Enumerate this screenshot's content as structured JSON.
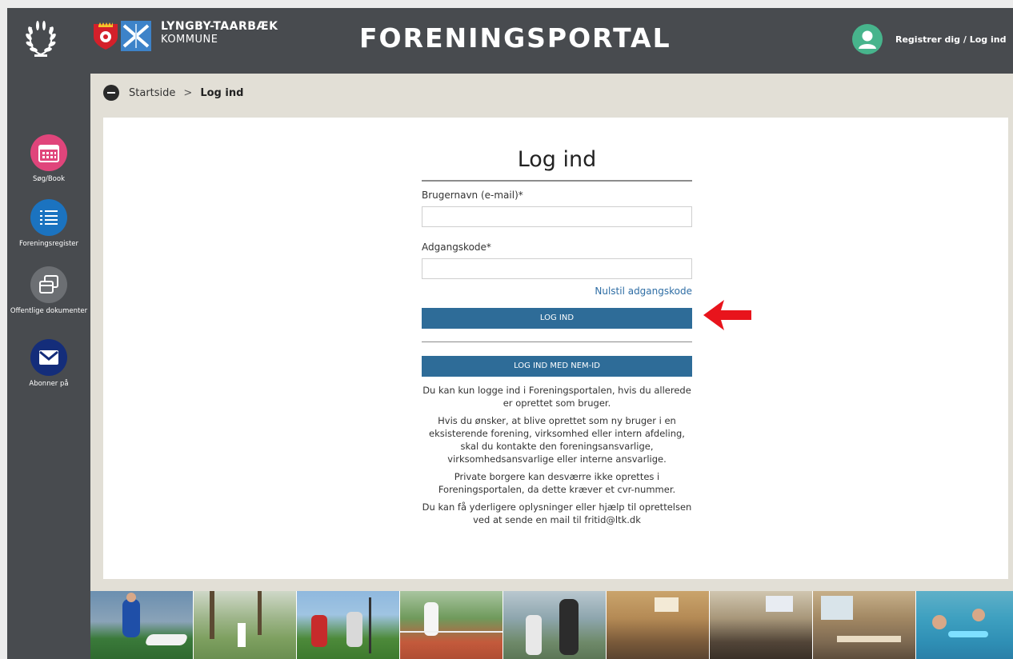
{
  "header": {
    "brand_line1": "LYNGBY-TAARBÆK",
    "brand_line2": "KOMMUNE",
    "portal_title": "FORENINGSPORTAL",
    "login_link": "Registrer dig / Log ind"
  },
  "sidebar": {
    "items": [
      {
        "label": "Søg/Book",
        "icon": "calendar-icon",
        "color": "#e0457b"
      },
      {
        "label": "Foreningsregister",
        "icon": "list-icon",
        "color": "#1b73c0"
      },
      {
        "label": "Offentlige dokumenter",
        "icon": "documents-icon",
        "color": "#6c6f73"
      },
      {
        "label": "Abonner på",
        "icon": "envelope-icon",
        "color": "#142d7a"
      }
    ]
  },
  "breadcrumb": {
    "home": "Startside",
    "separator": ">",
    "current": "Log ind"
  },
  "login": {
    "title": "Log ind",
    "username_label": "Brugernavn (e-mail)*",
    "username_value": "",
    "password_label": "Adgangskode*",
    "password_value": "",
    "reset_link": "Nulstil adgangskode",
    "login_button": "LOG IND",
    "nemid_button": "LOG IND MED NEM-ID",
    "info": [
      "Du kan kun logge ind i Foreningsportalen, hvis du allerede er oprettet som bruger.",
      "Hvis du ønsker, at blive oprettet som ny bruger i en eksisterende forening, virksomhed eller intern afdeling, skal du kontakte den foreningsansvarlige, virksomhedsansvarlige eller interne ansvarlige.",
      "Private borgere kan desværre ikke oprettes i Foreningsportalen, da dette kræver et cvr-nummer.",
      "Du kan få yderligere oplysninger eller hjælp til oprettelsen ved at sende en mail til fritid@ltk.dk"
    ]
  },
  "colors": {
    "header_bg": "#484b4f",
    "button_blue": "#2e6c98",
    "arrow_red": "#e8141c",
    "avatar_green": "#47b48c"
  }
}
